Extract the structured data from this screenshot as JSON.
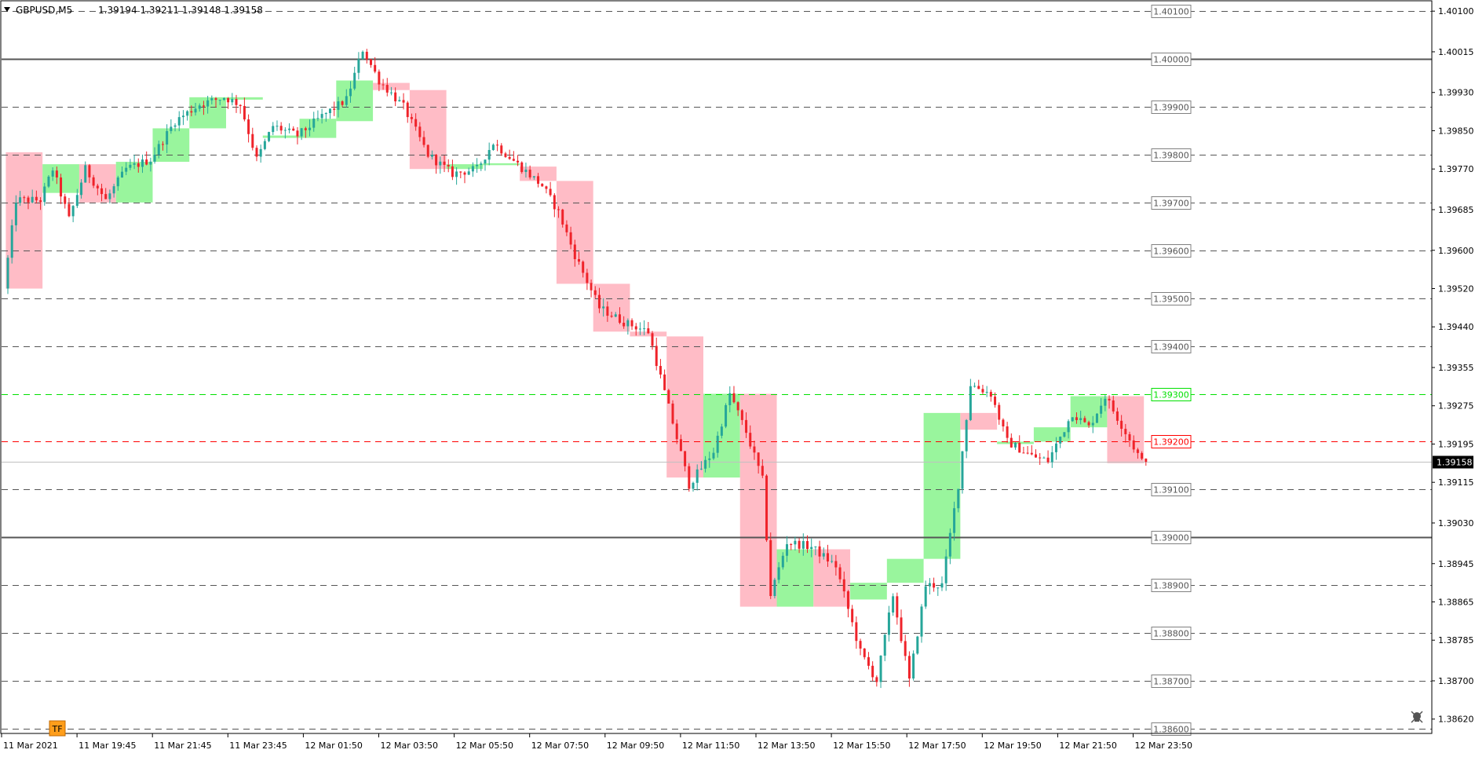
{
  "window": {
    "symbol": "GBPUSD,M5",
    "ohlc": "1.39194 1.39211 1.39148 1.39158",
    "tf_badge": "TF"
  },
  "colors": {
    "background": "#ffffff",
    "axis": "#000000",
    "grid": "#000000",
    "bull_candle": "#26a69a",
    "bear_candle": "#ef232a",
    "bull_box": "#99f59d",
    "bear_box": "#ffbcc6",
    "green_level": "#00e000",
    "red_level": "#ff0000",
    "current_price_bg": "#000000"
  },
  "chart_data": {
    "type": "candlestick",
    "title": "",
    "xlabel": "",
    "ylabel": "",
    "ylim": [
      1.3859,
      1.4012
    ],
    "price_axis_ticks": [
      "1.40100",
      "1.40015",
      "1.39930",
      "1.39850",
      "1.39770",
      "1.39685",
      "1.39600",
      "1.39520",
      "1.39440",
      "1.39355",
      "1.39275",
      "1.39195",
      "1.39115",
      "1.39030",
      "1.38945",
      "1.38865",
      "1.38785",
      "1.38700",
      "1.38620"
    ],
    "time_axis_ticks": [
      "11 Mar 2021",
      "11 Mar 19:45",
      "11 Mar 21:45",
      "11 Mar 23:45",
      "12 Mar 01:50",
      "12 Mar 03:50",
      "12 Mar 05:50",
      "12 Mar 07:50",
      "12 Mar 09:50",
      "12 Mar 11:50",
      "12 Mar 13:50",
      "12 Mar 15:50",
      "12 Mar 17:50",
      "12 Mar 19:50",
      "12 Mar 21:50",
      "12 Mar 23:50"
    ],
    "level_lines": [
      {
        "price": 1.401,
        "label": "1.40100",
        "style": "dashed",
        "color": "#555555"
      },
      {
        "price": 1.4,
        "label": "1.40000",
        "style": "solid",
        "color": "#555555"
      },
      {
        "price": 1.399,
        "label": "1.39900",
        "style": "dashed",
        "color": "#555555"
      },
      {
        "price": 1.398,
        "label": "1.39800",
        "style": "dashed",
        "color": "#555555"
      },
      {
        "price": 1.397,
        "label": "1.39700",
        "style": "dashed",
        "color": "#555555"
      },
      {
        "price": 1.396,
        "label": "1.39600",
        "style": "dashed",
        "color": "#555555"
      },
      {
        "price": 1.395,
        "label": "1.39500",
        "style": "dashed",
        "color": "#555555"
      },
      {
        "price": 1.394,
        "label": "1.39400",
        "style": "dashed",
        "color": "#555555"
      },
      {
        "price": 1.393,
        "label": "1.39300",
        "style": "dashed",
        "color": "#00e000"
      },
      {
        "price": 1.392,
        "label": "1.39200",
        "style": "dashed",
        "color": "#ff0000"
      },
      {
        "price": 1.391,
        "label": "1.39100",
        "style": "dashed",
        "color": "#555555"
      },
      {
        "price": 1.39,
        "label": "1.39000",
        "style": "solid",
        "color": "#555555"
      },
      {
        "price": 1.389,
        "label": "1.38900",
        "style": "dashed",
        "color": "#555555"
      },
      {
        "price": 1.388,
        "label": "1.38800",
        "style": "dashed",
        "color": "#555555"
      },
      {
        "price": 1.387,
        "label": "1.38700",
        "style": "dashed",
        "color": "#555555"
      },
      {
        "price": 1.386,
        "label": "1.38600",
        "style": "dashed",
        "color": "#555555"
      }
    ],
    "current_price": {
      "price": 1.39158,
      "label": "1.39158"
    },
    "session_boxes": [
      {
        "start": 0,
        "end": 9,
        "open": 1.39805,
        "close": 1.3952,
        "dir": "bear"
      },
      {
        "start": 9,
        "end": 18,
        "open": 1.3972,
        "close": 1.3978,
        "dir": "bull"
      },
      {
        "start": 18,
        "end": 27,
        "open": 1.3978,
        "close": 1.397,
        "dir": "bear"
      },
      {
        "start": 27,
        "end": 36,
        "open": 1.397,
        "close": 1.39785,
        "dir": "bull"
      },
      {
        "start": 36,
        "end": 45,
        "open": 1.39785,
        "close": 1.39855,
        "dir": "bull"
      },
      {
        "start": 45,
        "end": 54,
        "open": 1.39855,
        "close": 1.3992,
        "dir": "bull"
      },
      {
        "start": 54,
        "end": 63,
        "open": 1.3992,
        "close": 1.39915,
        "dir": "bull"
      },
      {
        "start": 63,
        "end": 72,
        "open": 1.39835,
        "close": 1.3984,
        "dir": "bull"
      },
      {
        "start": 72,
        "end": 81,
        "open": 1.39875,
        "close": 1.39835,
        "dir": "bull"
      },
      {
        "start": 81,
        "end": 90,
        "open": 1.3987,
        "close": 1.39955,
        "dir": "bull"
      },
      {
        "start": 90,
        "end": 99,
        "open": 1.3995,
        "close": 1.39935,
        "dir": "bear"
      },
      {
        "start": 99,
        "end": 108,
        "open": 1.39935,
        "close": 1.3977,
        "dir": "bear"
      },
      {
        "start": 108,
        "end": 117,
        "open": 1.3977,
        "close": 1.3978,
        "dir": "bull"
      },
      {
        "start": 117,
        "end": 126,
        "open": 1.39778,
        "close": 1.39782,
        "dir": "bull"
      },
      {
        "start": 126,
        "end": 135,
        "open": 1.39775,
        "close": 1.39745,
        "dir": "bear"
      },
      {
        "start": 135,
        "end": 144,
        "open": 1.39745,
        "close": 1.3953,
        "dir": "bear"
      },
      {
        "start": 144,
        "end": 153,
        "open": 1.3953,
        "close": 1.3943,
        "dir": "bear"
      },
      {
        "start": 153,
        "end": 162,
        "open": 1.3943,
        "close": 1.3942,
        "dir": "bear"
      },
      {
        "start": 162,
        "end": 171,
        "open": 1.3942,
        "close": 1.39125,
        "dir": "bear"
      },
      {
        "start": 171,
        "end": 180,
        "open": 1.39125,
        "close": 1.393,
        "dir": "bull"
      },
      {
        "start": 180,
        "end": 189,
        "open": 1.393,
        "close": 1.38855,
        "dir": "bear"
      },
      {
        "start": 189,
        "end": 198,
        "open": 1.38855,
        "close": 1.38975,
        "dir": "bull"
      },
      {
        "start": 198,
        "end": 207,
        "open": 1.38975,
        "close": 1.38855,
        "dir": "bear"
      },
      {
        "start": 207,
        "end": 216,
        "open": 1.3887,
        "close": 1.38905,
        "dir": "bull"
      },
      {
        "start": 216,
        "end": 225,
        "open": 1.38905,
        "close": 1.38955,
        "dir": "bull"
      },
      {
        "start": 225,
        "end": 234,
        "open": 1.38955,
        "close": 1.3926,
        "dir": "bull"
      },
      {
        "start": 234,
        "end": 243,
        "open": 1.3926,
        "close": 1.39225,
        "dir": "bear"
      },
      {
        "start": 243,
        "end": 252,
        "open": 1.39195,
        "close": 1.392,
        "dir": "bull"
      },
      {
        "start": 252,
        "end": 261,
        "open": 1.392,
        "close": 1.3923,
        "dir": "bull"
      },
      {
        "start": 261,
        "end": 270,
        "open": 1.3923,
        "close": 1.39295,
        "dir": "bull"
      },
      {
        "start": 270,
        "end": 279,
        "open": 1.39295,
        "close": 1.39155,
        "dir": "bear"
      }
    ],
    "path_anchors": [
      [
        0,
        1.3952
      ],
      [
        3,
        1.39705
      ],
      [
        9,
        1.39705
      ],
      [
        12,
        1.3977
      ],
      [
        16,
        1.39665
      ],
      [
        20,
        1.3977
      ],
      [
        25,
        1.39705
      ],
      [
        30,
        1.3977
      ],
      [
        36,
        1.3979
      ],
      [
        42,
        1.3987
      ],
      [
        48,
        1.39905
      ],
      [
        54,
        1.3992
      ],
      [
        58,
        1.39905
      ],
      [
        62,
        1.3979
      ],
      [
        66,
        1.3986
      ],
      [
        72,
        1.3984
      ],
      [
        78,
        1.3988
      ],
      [
        84,
        1.39915
      ],
      [
        88,
        1.4002
      ],
      [
        92,
        1.39955
      ],
      [
        98,
        1.399
      ],
      [
        104,
        1.398
      ],
      [
        110,
        1.3976
      ],
      [
        116,
        1.3977
      ],
      [
        120,
        1.39825
      ],
      [
        126,
        1.3978
      ],
      [
        132,
        1.39735
      ],
      [
        136,
        1.3968
      ],
      [
        140,
        1.3959
      ],
      [
        146,
        1.3948
      ],
      [
        152,
        1.3945
      ],
      [
        158,
        1.3943
      ],
      [
        164,
        1.3924
      ],
      [
        168,
        1.3911
      ],
      [
        174,
        1.3918
      ],
      [
        178,
        1.393
      ],
      [
        182,
        1.3922
      ],
      [
        186,
        1.3912
      ],
      [
        188,
        1.3888
      ],
      [
        192,
        1.3899
      ],
      [
        198,
        1.3898
      ],
      [
        204,
        1.3894
      ],
      [
        210,
        1.3876
      ],
      [
        214,
        1.387
      ],
      [
        218,
        1.3888
      ],
      [
        222,
        1.387
      ],
      [
        226,
        1.389
      ],
      [
        230,
        1.389
      ],
      [
        234,
        1.3911
      ],
      [
        237,
        1.3932
      ],
      [
        242,
        1.393
      ],
      [
        246,
        1.392
      ],
      [
        252,
        1.3917
      ],
      [
        256,
        1.3916
      ],
      [
        262,
        1.3926
      ],
      [
        266,
        1.3923
      ],
      [
        270,
        1.39295
      ],
      [
        275,
        1.3922
      ],
      [
        279,
        1.39158
      ]
    ],
    "candle_count": 280
  }
}
